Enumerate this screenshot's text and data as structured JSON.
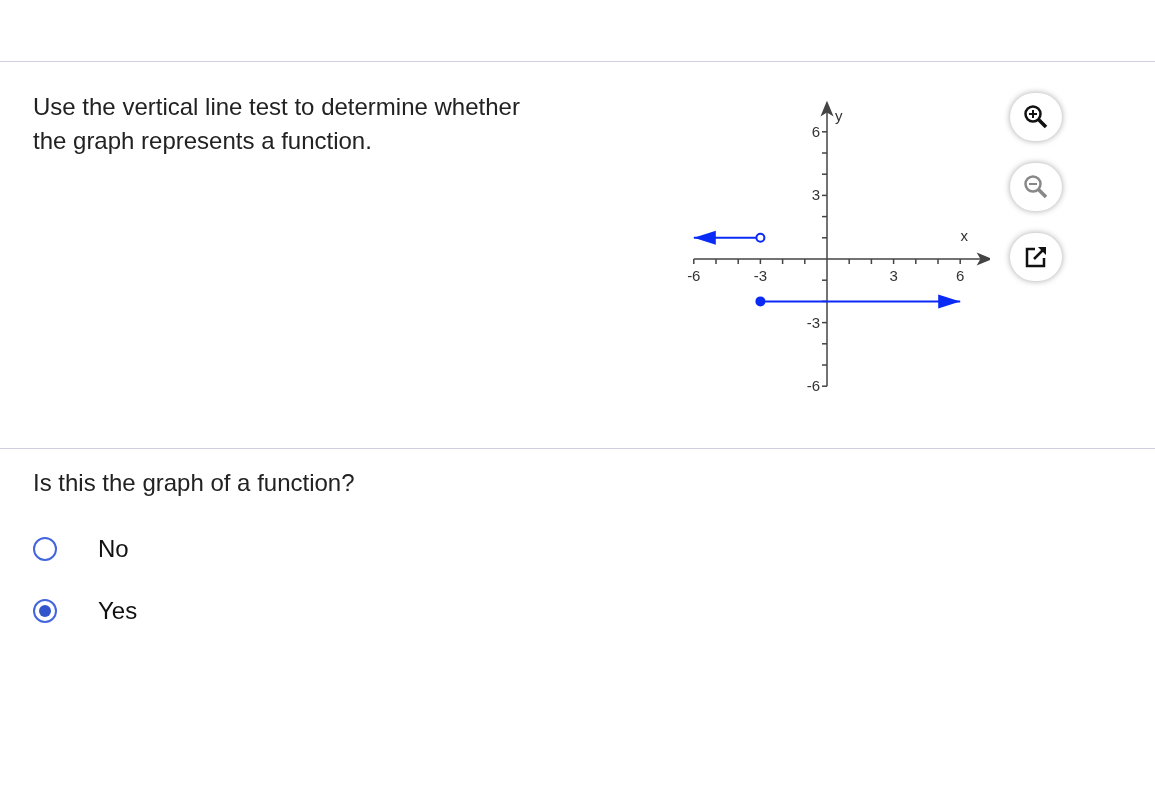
{
  "prompt": "Use the vertical line test to determine whether the graph represents a function.",
  "graph": {
    "endpoints": [
      {
        "filled": false
      },
      {
        "filled": true
      }
    ],
    "chart_data": {
      "type": "line",
      "xlabel": "x",
      "ylabel": "y",
      "xlim": [
        -6,
        7
      ],
      "ylim": [
        -6,
        7
      ],
      "xticks": [
        -6,
        -3,
        3,
        6
      ],
      "yticks": [
        -6,
        -3,
        3,
        6
      ],
      "series": [
        {
          "color": "#0a2bf5",
          "x": [
            -3,
            -6
          ],
          "values": [
            1,
            1
          ]
        },
        {
          "color": "#0a2bf5",
          "x": [
            -3,
            6
          ],
          "values": [
            -2,
            -2
          ]
        }
      ]
    }
  },
  "tools": [
    {
      "kind": "zoom-in",
      "disabled": false
    },
    {
      "kind": "zoom-out",
      "disabled": true
    },
    {
      "kind": "popout",
      "disabled": false
    }
  ],
  "question": "Is this the graph of a function?",
  "options": [
    {
      "label": "No",
      "selected": false
    },
    {
      "label": "Yes",
      "selected": true
    }
  ]
}
